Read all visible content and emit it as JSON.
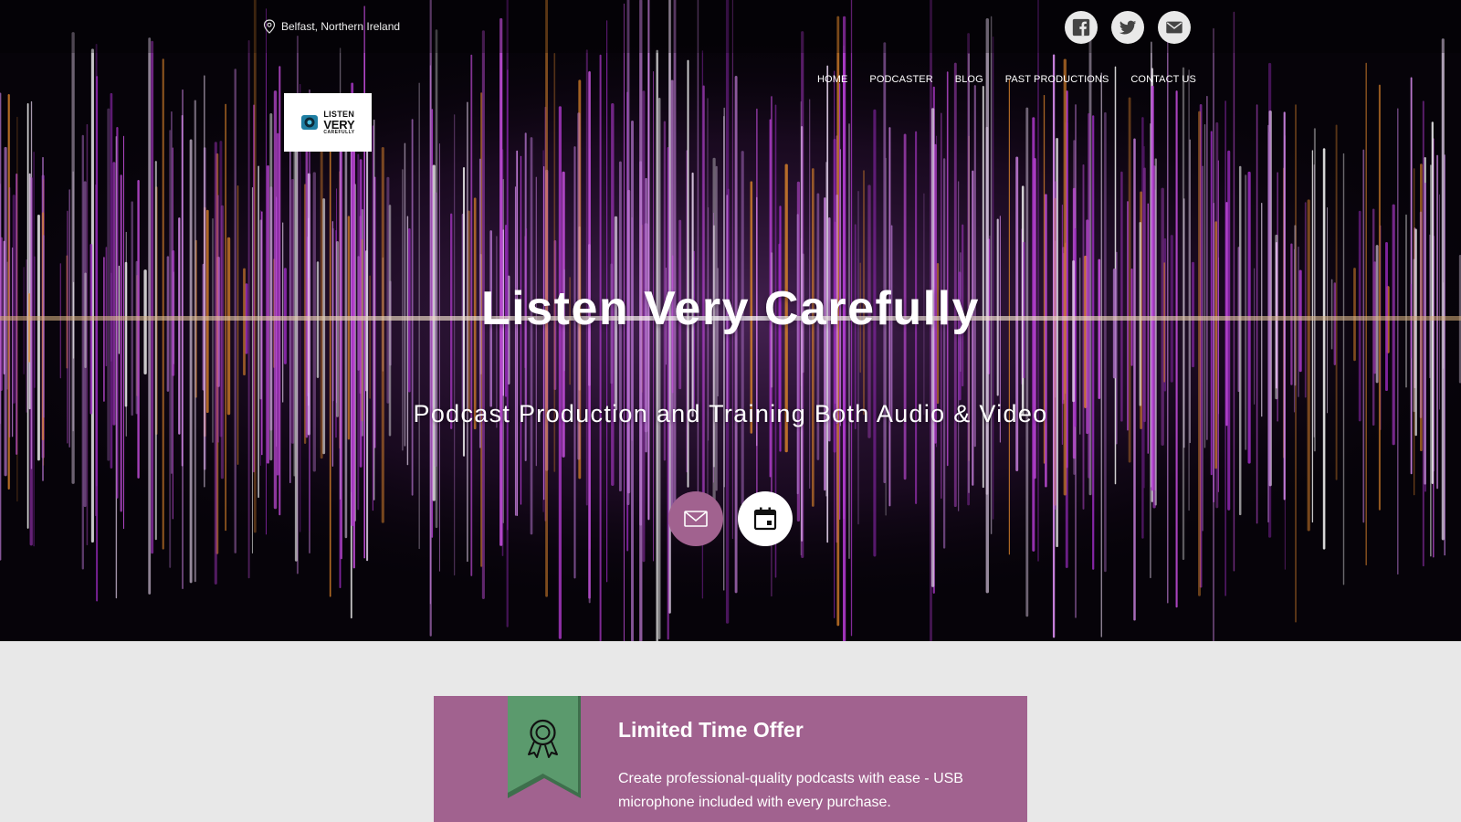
{
  "topbar": {
    "location": "Belfast, Northern Ireland",
    "social": [
      {
        "name": "facebook-icon"
      },
      {
        "name": "twitter-icon"
      },
      {
        "name": "email-icon"
      }
    ]
  },
  "nav": {
    "items": [
      "HOME",
      "PODCASTER",
      "BLOG",
      "PAST PRODUCTIONS",
      "CONTACT US"
    ]
  },
  "logo": {
    "line1": "LISTEN",
    "line2": "VERY",
    "line3": "CAREFULLY"
  },
  "hero": {
    "title": "Listen Very Carefully",
    "subtitle": "Podcast Production and Training Both Audio & Video",
    "buttons": [
      {
        "icon": "mail-icon"
      },
      {
        "icon": "calendar-icon"
      }
    ]
  },
  "offer": {
    "title": "Limited Time Offer",
    "text": "Create professional-quality podcasts with ease - USB microphone included with every purchase.",
    "icon": "award-ribbon-icon"
  },
  "colors": {
    "accent": "#a1628f",
    "ribbon": "#5b9a6d",
    "page_bg": "#e8e8e8"
  }
}
